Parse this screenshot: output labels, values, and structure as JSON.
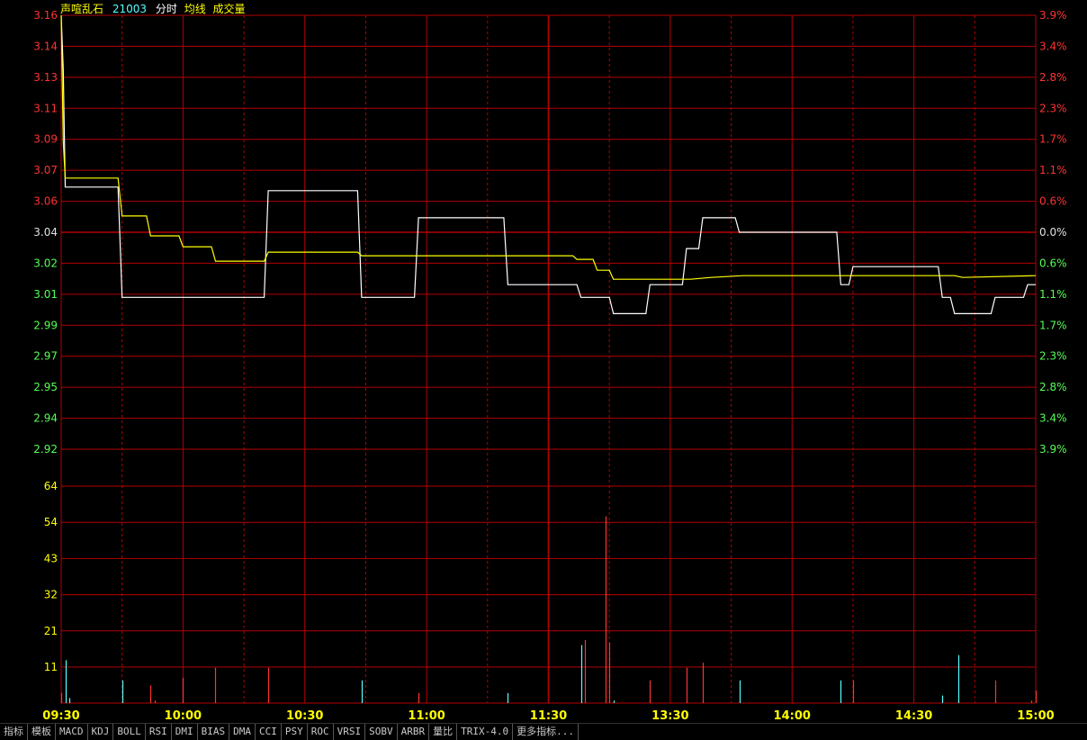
{
  "header": {
    "name": "声喧乱石",
    "code": "21003",
    "label_mode": "分时",
    "label_avg": "均线",
    "label_volume": "成交量"
  },
  "colors": {
    "grid": "#b40000",
    "price_line": "#ffffff",
    "avg_line": "#ffff00",
    "up": "#ff3232",
    "down": "#54ffff",
    "up_label": "#ff3232",
    "down_label": "#54ff54",
    "neutral_label": "#e0e0e0",
    "volume_label": "#ffff00",
    "time_label": "#ffff00"
  },
  "tabs": [
    "指标",
    "模板",
    "MACD",
    "KDJ",
    "BOLL",
    "RSI",
    "DMI",
    "BIAS",
    "DMA",
    "CCI",
    "PSY",
    "ROC",
    "VRSI",
    "SOBV",
    "ARBR",
    "量比",
    "TRIX-4.0",
    "更多指标..."
  ],
  "chart_data": {
    "type": "line",
    "title": "",
    "price_axis": {
      "ticks": [
        "3.16",
        "3.14",
        "3.13",
        "3.11",
        "3.09",
        "3.07",
        "3.06",
        "3.04",
        "3.02",
        "3.01",
        "2.99",
        "2.97",
        "2.95",
        "2.94",
        "2.92"
      ],
      "ylim": [
        2.92,
        3.16
      ],
      "base_price": 3.04
    },
    "percent_axis": {
      "ticks": [
        "3.9%",
        "3.4%",
        "2.8%",
        "2.3%",
        "1.7%",
        "1.1%",
        "0.6%",
        "0.0%",
        "0.6%",
        "1.1%",
        "1.7%",
        "2.3%",
        "2.8%",
        "3.4%",
        "3.9%"
      ]
    },
    "volume_axis": {
      "ticks": [
        "64",
        "54",
        "43",
        "32",
        "21",
        "11"
      ],
      "ylim": [
        0,
        86
      ]
    },
    "time_axis": {
      "ticks": [
        "09:30",
        "10:00",
        "10:30",
        "11:00",
        "11:30",
        "13:30",
        "14:00",
        "14:30",
        "15:00"
      ],
      "total_minutes": 240
    },
    "series": [
      {
        "name": "分时",
        "points": [
          [
            0,
            3.16
          ],
          [
            0.5,
            3.13
          ],
          [
            1,
            3.065
          ],
          [
            14,
            3.065
          ],
          [
            15,
            3.004
          ],
          [
            50,
            3.004
          ],
          [
            51,
            3.063
          ],
          [
            73,
            3.063
          ],
          [
            74,
            3.004
          ],
          [
            87,
            3.004
          ],
          [
            88,
            3.048
          ],
          [
            109,
            3.048
          ],
          [
            110,
            3.011
          ],
          [
            127,
            3.011
          ],
          [
            128,
            3.004
          ],
          [
            135,
            3.004
          ],
          [
            136,
            2.995
          ],
          [
            144,
            2.995
          ],
          [
            145,
            3.011
          ],
          [
            153,
            3.011
          ],
          [
            154,
            3.031
          ],
          [
            157,
            3.031
          ],
          [
            158,
            3.048
          ],
          [
            166,
            3.048
          ],
          [
            167,
            3.04
          ],
          [
            191,
            3.04
          ],
          [
            192,
            3.011
          ],
          [
            194,
            3.011
          ],
          [
            195,
            3.021
          ],
          [
            216,
            3.021
          ],
          [
            217,
            3.004
          ],
          [
            219,
            3.004
          ],
          [
            220,
            2.995
          ],
          [
            229,
            2.995
          ],
          [
            230,
            3.004
          ],
          [
            237,
            3.004
          ],
          [
            238,
            3.011
          ],
          [
            240,
            3.011
          ]
        ]
      },
      {
        "name": "均线",
        "points": [
          [
            0,
            3.16
          ],
          [
            0.5,
            3.09
          ],
          [
            1,
            3.07
          ],
          [
            14,
            3.07
          ],
          [
            15,
            3.049
          ],
          [
            21,
            3.049
          ],
          [
            22,
            3.038
          ],
          [
            29,
            3.038
          ],
          [
            30,
            3.032
          ],
          [
            37,
            3.032
          ],
          [
            38,
            3.024
          ],
          [
            50,
            3.024
          ],
          [
            51,
            3.029
          ],
          [
            73,
            3.029
          ],
          [
            74,
            3.027
          ],
          [
            88,
            3.027
          ],
          [
            89,
            3.027
          ],
          [
            126,
            3.027
          ],
          [
            127,
            3.025
          ],
          [
            131,
            3.025
          ],
          [
            132,
            3.019
          ],
          [
            135,
            3.019
          ],
          [
            136,
            3.014
          ],
          [
            149,
            3.014
          ],
          [
            155,
            3.014
          ],
          [
            160,
            3.015
          ],
          [
            168,
            3.016
          ],
          [
            200,
            3.016
          ],
          [
            220,
            3.016
          ],
          [
            222,
            3.015
          ],
          [
            240,
            3.016
          ]
        ]
      }
    ],
    "volume": [
      {
        "t": 0,
        "v": 4,
        "dir": "up"
      },
      {
        "t": 1,
        "v": 17,
        "dir": "down"
      },
      {
        "t": 2,
        "v": 2,
        "dir": "down"
      },
      {
        "t": 15,
        "v": 9,
        "dir": "down"
      },
      {
        "t": 22,
        "v": 7,
        "dir": "up"
      },
      {
        "t": 23,
        "v": 1,
        "dir": "up"
      },
      {
        "t": 30,
        "v": 10,
        "dir": "up"
      },
      {
        "t": 38,
        "v": 14,
        "dir": "up"
      },
      {
        "t": 51,
        "v": 14,
        "dir": "up"
      },
      {
        "t": 74,
        "v": 9,
        "dir": "down"
      },
      {
        "t": 88,
        "v": 4,
        "dir": "up"
      },
      {
        "t": 110,
        "v": 4,
        "dir": "down"
      },
      {
        "t": 128,
        "v": 23,
        "dir": "down"
      },
      {
        "t": 129,
        "v": 25,
        "dir": "up"
      },
      {
        "t": 134,
        "v": 74,
        "dir": "up"
      },
      {
        "t": 135,
        "v": 24,
        "dir": "up"
      },
      {
        "t": 136,
        "v": 1,
        "dir": "down"
      },
      {
        "t": 145,
        "v": 9,
        "dir": "up"
      },
      {
        "t": 154,
        "v": 14,
        "dir": "up"
      },
      {
        "t": 158,
        "v": 16,
        "dir": "up"
      },
      {
        "t": 167,
        "v": 9,
        "dir": "down"
      },
      {
        "t": 192,
        "v": 9,
        "dir": "down"
      },
      {
        "t": 195,
        "v": 9,
        "dir": "up"
      },
      {
        "t": 217,
        "v": 3,
        "dir": "down"
      },
      {
        "t": 221,
        "v": 19,
        "dir": "down"
      },
      {
        "t": 230,
        "v": 9,
        "dir": "up"
      },
      {
        "t": 239,
        "v": 1,
        "dir": "up"
      },
      {
        "t": 240,
        "v": 5,
        "dir": "up"
      }
    ]
  }
}
